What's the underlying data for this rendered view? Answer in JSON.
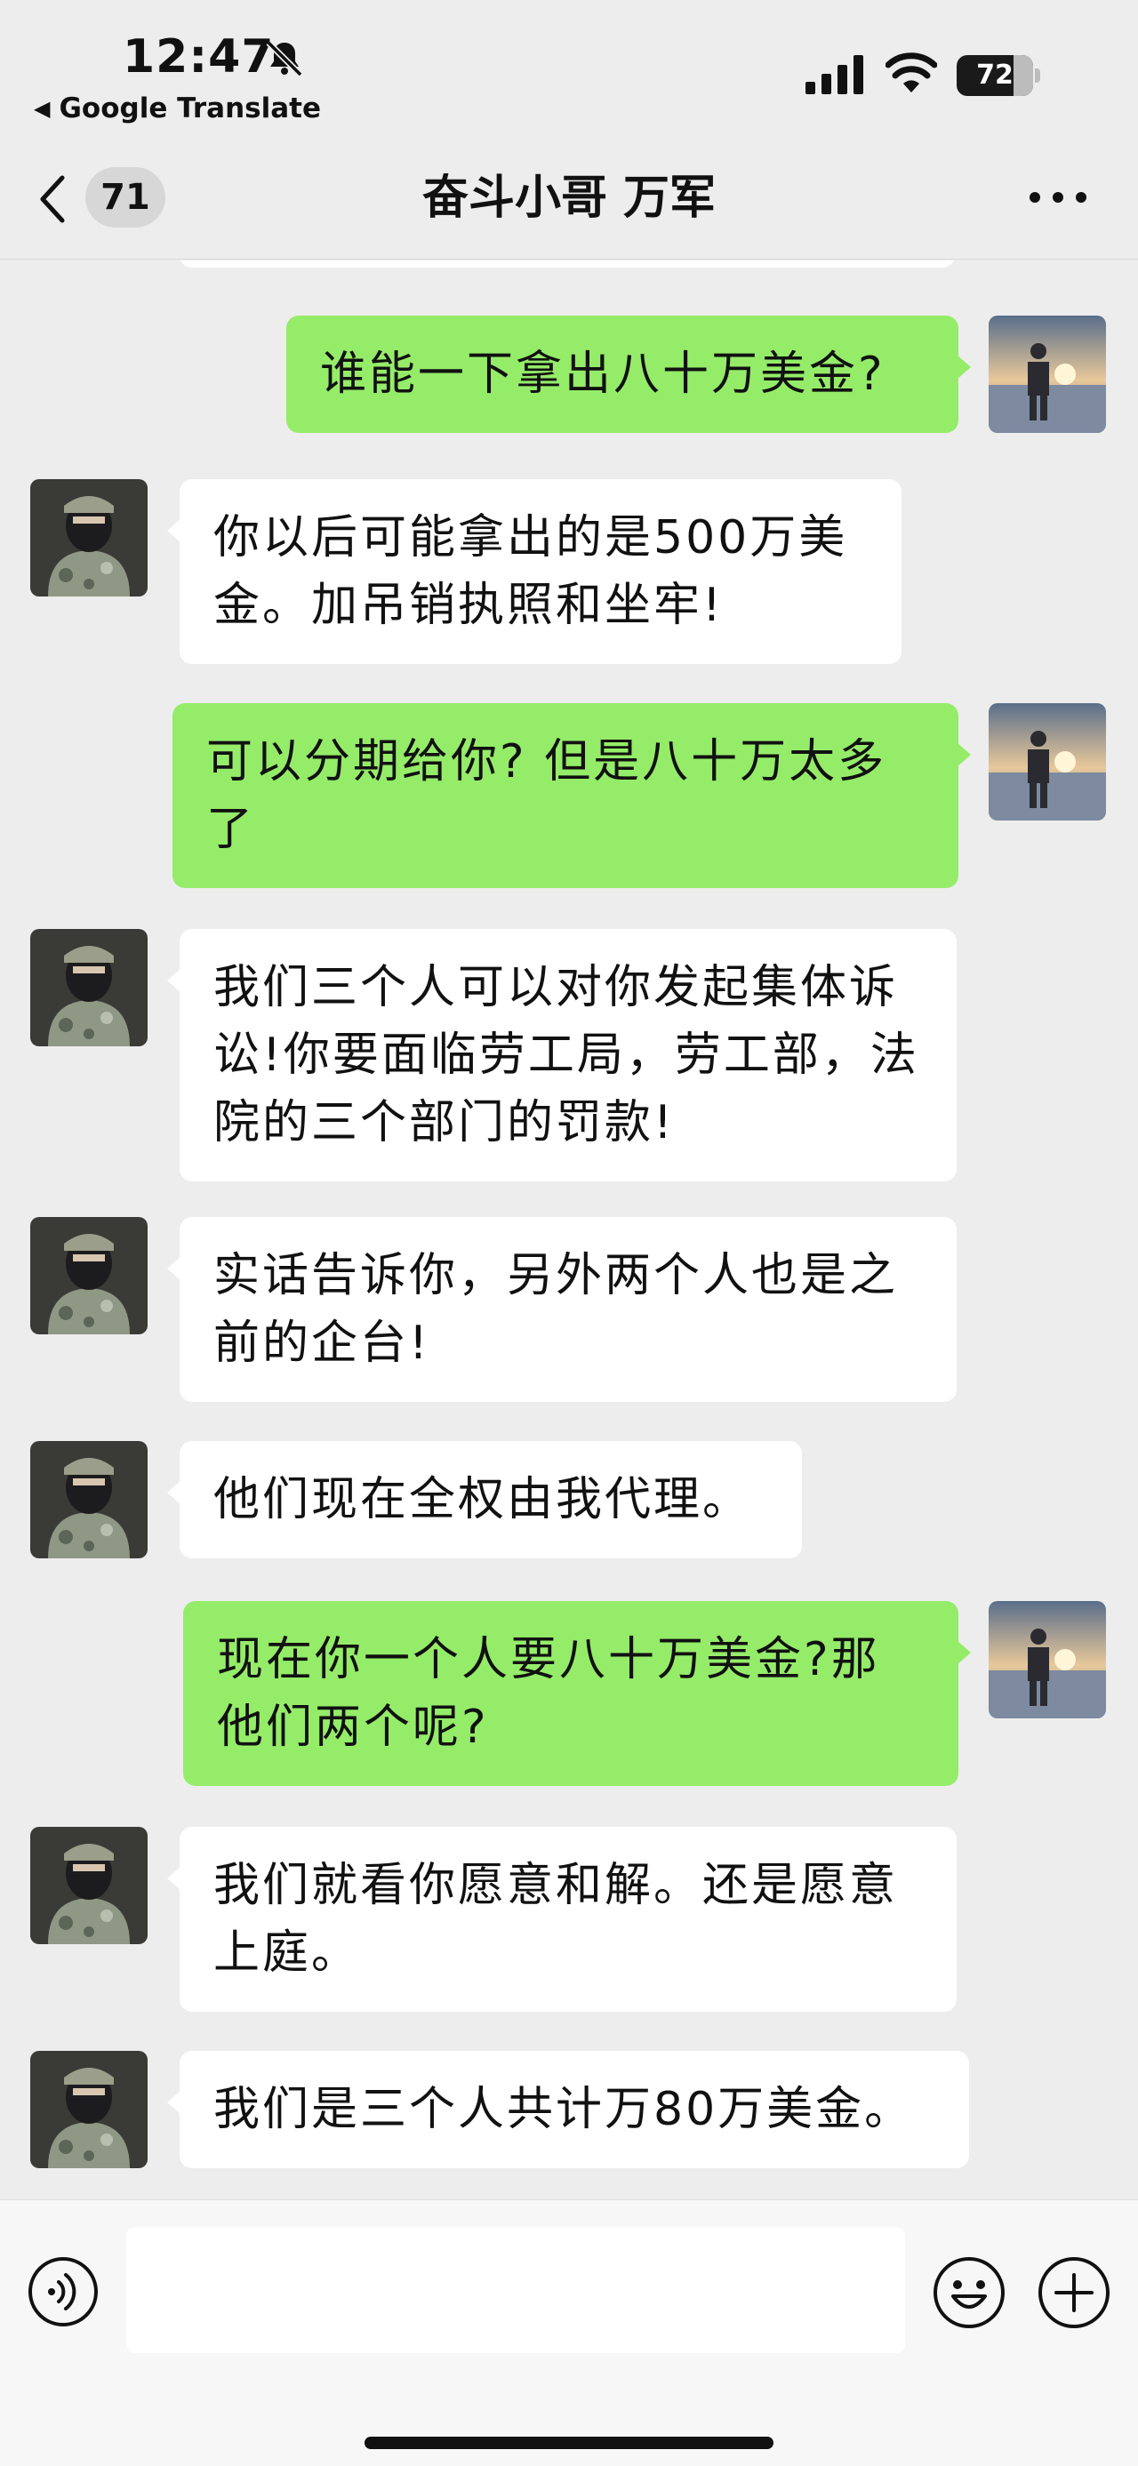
{
  "status_bar": {
    "time": "12:47",
    "back_app": "Google Translate",
    "battery": "72",
    "icons": [
      "bell-slash-icon",
      "signal-icon",
      "wifi-icon",
      "battery-icon"
    ]
  },
  "nav": {
    "unread_count": "71",
    "title": "奋斗小哥 万军",
    "icons": [
      "chevron-left-icon",
      "more-icon"
    ]
  },
  "messages": [
    {
      "side": "out",
      "text": "谁能一下拿出八十万美金?"
    },
    {
      "side": "in",
      "text": "你以后可能拿出的是500万美金。加吊销执照和坐牢!"
    },
    {
      "side": "out",
      "text": "可以分期给你? 但是八十万太多了"
    },
    {
      "side": "in",
      "text": "我们三个人可以对你发起集体诉讼!你要面临劳工局，劳工部，法院的三个部门的罚款!"
    },
    {
      "side": "in",
      "text": "实话告诉你，另外两个人也是之前的企台!"
    },
    {
      "side": "in",
      "text": "他们现在全权由我代理。"
    },
    {
      "side": "out",
      "text": "现在你一个人要八十万美金?那他们两个呢?"
    },
    {
      "side": "in",
      "text": "我们就看你愿意和解。还是愿意上庭。"
    },
    {
      "side": "in",
      "text": "我们是三个人共计万80万美金。"
    }
  ],
  "input_bar": {
    "placeholder": "",
    "icons": [
      "voice-icon",
      "emoji-icon",
      "plus-icon"
    ]
  },
  "colors": {
    "background": "#ededed",
    "outgoing_bubble": "#95ec69",
    "incoming_bubble": "#ffffff"
  }
}
